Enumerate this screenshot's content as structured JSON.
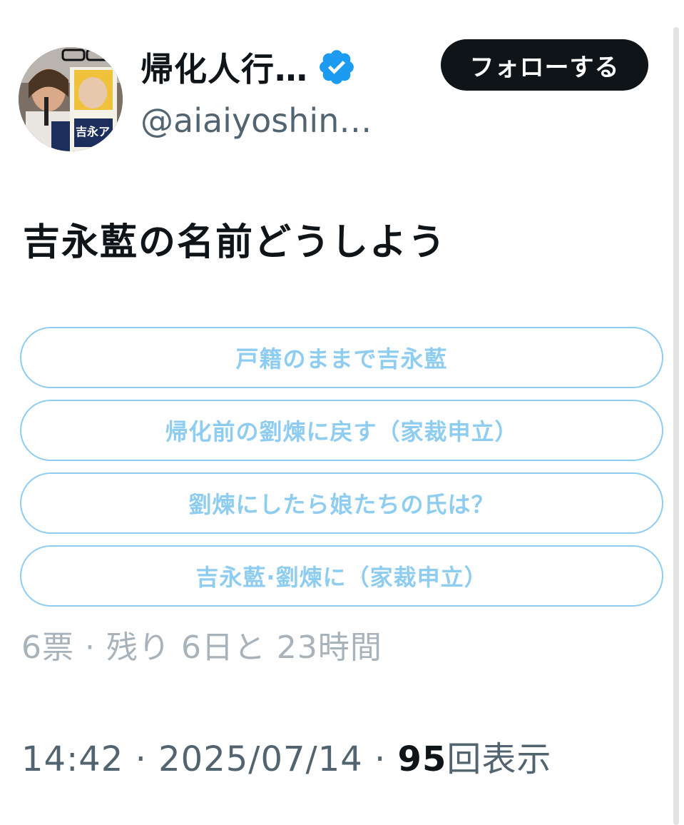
{
  "author": {
    "display_name": "帰化人行…",
    "handle": "@aiaiyoshin…",
    "verified": true,
    "avatar_sign_text": "吉永ア"
  },
  "follow_button_label": "フォローする",
  "tweet": {
    "text": "吉永藍の名前どうしよう"
  },
  "poll": {
    "options": [
      "戸籍のままで吉永藍",
      "帰化前の劉煉に戻す（家裁申立）",
      "劉煉にしたら娘たちの氏は？",
      "吉永藍·劉煉に（家裁申立）"
    ],
    "meta": "6票 · 残り 6日と 23時間"
  },
  "footer": {
    "time": "14:42",
    "separator": " · ",
    "date": "2025/07/14",
    "views_count": "95",
    "views_label": "回表示"
  },
  "colors": {
    "poll_accent": "#8ecdf0",
    "verified_badge": "#1d9bf0",
    "follow_bg": "#0f1419",
    "secondary_text": "#536471",
    "muted_text": "#a8b2ba"
  }
}
